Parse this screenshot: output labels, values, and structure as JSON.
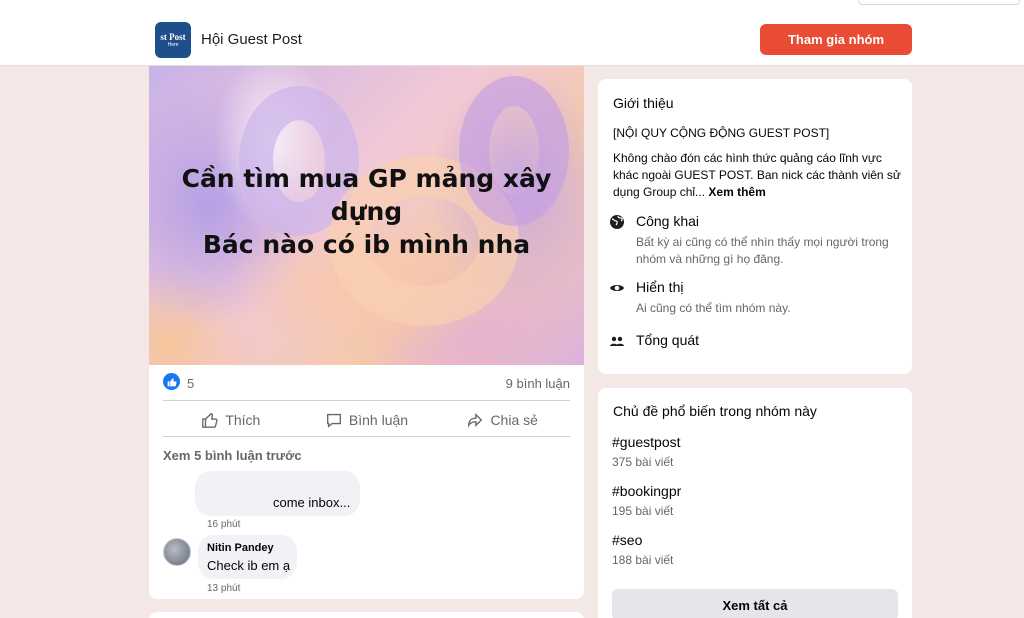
{
  "header": {
    "group_logo_line1": "st Post",
    "group_logo_line2": "Here",
    "group_name": "Hội Guest Post",
    "join_label": "Tham gia nhóm"
  },
  "post": {
    "image_text_line1": "Cần tìm mua GP mảng xây",
    "image_text_line2": "dựng",
    "image_text_line3": "Bác nào có ib mình nha",
    "reaction_count": "5",
    "comment_count": "9 bình luận",
    "actions": {
      "like": "Thích",
      "comment": "Bình luận",
      "share": "Chia sẻ"
    },
    "previous_comments": "Xem 5 bình luận trước",
    "comments": [
      {
        "author": "",
        "text": "come inbox...",
        "time": "16 phút"
      },
      {
        "author": "Nitin Pandey",
        "text": "Check ib em ạ",
        "time": "13 phút"
      }
    ]
  },
  "about": {
    "title": "Giới thiệu",
    "rules": "[NỘI QUY CỘNG ĐỘNG GUEST POST]",
    "description": "Không chào đón các hình thức quảng cáo lĩnh vực khác ngoài GUEST POST. Ban nick các thành viên sử dụng Group chỉ...",
    "see_more": "Xem thêm",
    "items": [
      {
        "title": "Công khai",
        "desc": "Bất kỳ ai cũng có thể nhìn thấy mọi người trong nhóm và những gì họ đăng.",
        "icon": "globe-icon"
      },
      {
        "title": "Hiển thị",
        "desc": "Ai cũng có thể tìm nhóm này.",
        "icon": "eye-icon"
      },
      {
        "title": "Tổng quát",
        "desc": "",
        "icon": "people-icon"
      }
    ]
  },
  "topics": {
    "title": "Chủ đề phổ biến trong nhóm này",
    "items": [
      {
        "tag": "#guestpost",
        "count": "375 bài viết"
      },
      {
        "tag": "#bookingpr",
        "count": "195 bài viết"
      },
      {
        "tag": "#seo",
        "count": "188 bài viết"
      }
    ],
    "see_all": "Xem tất cả"
  },
  "colors": {
    "accent": "#e94b35",
    "like_blue": "#1877f2",
    "page_background": "#f3e8e5"
  }
}
